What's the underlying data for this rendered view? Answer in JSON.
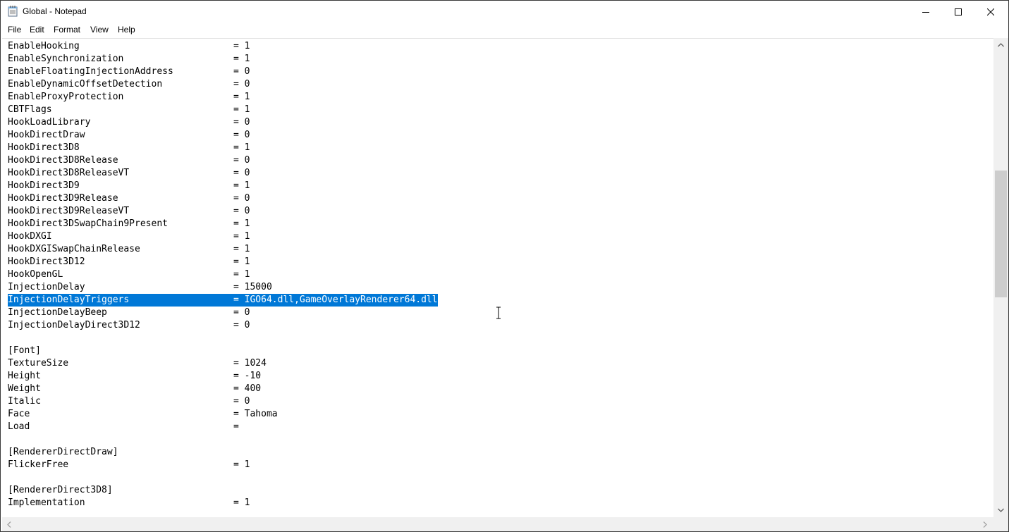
{
  "window": {
    "title": "Global - Notepad"
  },
  "menu": [
    "File",
    "Edit",
    "Format",
    "View",
    "Help"
  ],
  "lines": [
    {
      "k": "EnableHooking",
      "v": "= 1"
    },
    {
      "k": "EnableSynchronization",
      "v": "= 1"
    },
    {
      "k": "EnableFloatingInjectionAddress",
      "v": "= 0"
    },
    {
      "k": "EnableDynamicOffsetDetection",
      "v": "= 0"
    },
    {
      "k": "EnableProxyProtection",
      "v": "= 1"
    },
    {
      "k": "CBTFlags",
      "v": "= 1"
    },
    {
      "k": "HookLoadLibrary",
      "v": "= 0"
    },
    {
      "k": "HookDirectDraw",
      "v": "= 0"
    },
    {
      "k": "HookDirect3D8",
      "v": "= 1"
    },
    {
      "k": "HookDirect3D8Release",
      "v": "= 0"
    },
    {
      "k": "HookDirect3D8ReleaseVT",
      "v": "= 0"
    },
    {
      "k": "HookDirect3D9",
      "v": "= 1"
    },
    {
      "k": "HookDirect3D9Release",
      "v": "= 0"
    },
    {
      "k": "HookDirect3D9ReleaseVT",
      "v": "= 0"
    },
    {
      "k": "HookDirect3DSwapChain9Present",
      "v": "= 1"
    },
    {
      "k": "HookDXGI",
      "v": "= 1"
    },
    {
      "k": "HookDXGISwapChainRelease",
      "v": "= 1"
    },
    {
      "k": "HookDirect3D12",
      "v": "= 1"
    },
    {
      "k": "HookOpenGL",
      "v": "= 1"
    },
    {
      "k": "InjectionDelay",
      "v": "= 15000"
    },
    {
      "k": "InjectionDelayTriggers",
      "v": "= IGO64.dll,GameOverlayRenderer64.dll",
      "selected": true
    },
    {
      "k": "InjectionDelayBeep",
      "v": "= 0"
    },
    {
      "k": "InjectionDelayDirect3D12",
      "v": "= 0"
    },
    {
      "k": "",
      "v": ""
    },
    {
      "k": "[Font]",
      "v": ""
    },
    {
      "k": "TextureSize",
      "v": "= 1024"
    },
    {
      "k": "Height",
      "v": "= -10"
    },
    {
      "k": "Weight",
      "v": "= 400"
    },
    {
      "k": "Italic",
      "v": "= 0"
    },
    {
      "k": "Face",
      "v": "= Tahoma"
    },
    {
      "k": "Load",
      "v": "="
    },
    {
      "k": "",
      "v": ""
    },
    {
      "k": "[RendererDirectDraw]",
      "v": ""
    },
    {
      "k": "FlickerFree",
      "v": "= 1"
    },
    {
      "k": "",
      "v": ""
    },
    {
      "k": "[RendererDirect3D8]",
      "v": ""
    },
    {
      "k": "Implementation",
      "v": "= 1"
    }
  ],
  "colors": {
    "selection": "#0078d7",
    "scrollbar": "#f0f0f0",
    "thumb": "#cdcdcd"
  },
  "icons": {
    "app": "notepad-icon",
    "minimize": "minimize-icon",
    "maximize": "maximize-icon",
    "close": "close-icon"
  }
}
